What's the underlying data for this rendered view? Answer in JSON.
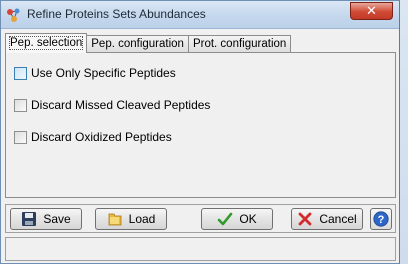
{
  "window": {
    "title": "Refine Proteins Sets Abundances",
    "close_label": "✕"
  },
  "tabs": [
    {
      "label": "Pep. selection",
      "active": true
    },
    {
      "label": "Pep. configuration",
      "active": false
    },
    {
      "label": "Prot. configuration",
      "active": false
    }
  ],
  "options": [
    {
      "label": "Use Only Specific Peptides",
      "checked": false
    },
    {
      "label": "Discard Missed Cleaved Peptides",
      "checked": false
    },
    {
      "label": "Discard Oxidized Peptides",
      "checked": false
    }
  ],
  "buttons": {
    "save": "Save",
    "load": "Load",
    "ok": "OK",
    "cancel": "Cancel",
    "help": "?"
  },
  "status": ""
}
